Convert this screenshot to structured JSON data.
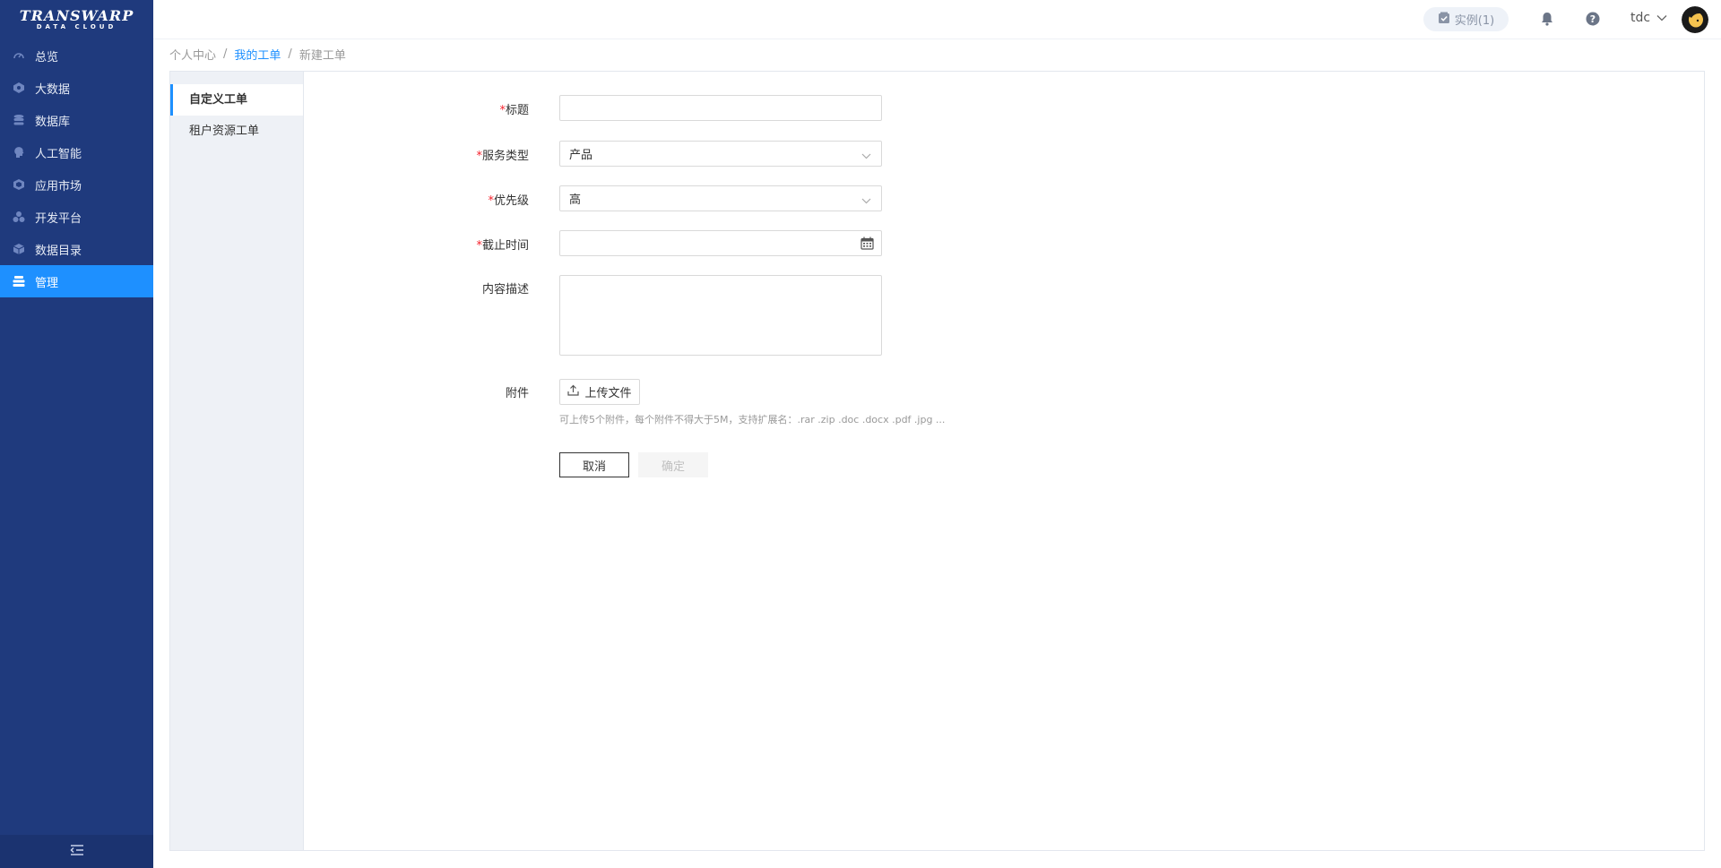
{
  "logo": {
    "line1": "TRANSWARP",
    "line2": "DATA CLOUD"
  },
  "sidebar": {
    "items": [
      {
        "label": "总览",
        "icon": "dashboard-icon",
        "active": false
      },
      {
        "label": "大数据",
        "icon": "bigdata-icon",
        "active": false
      },
      {
        "label": "数据库",
        "icon": "database-icon",
        "active": false
      },
      {
        "label": "人工智能",
        "icon": "ai-icon",
        "active": false
      },
      {
        "label": "应用市场",
        "icon": "app-market-icon",
        "active": false
      },
      {
        "label": "开发平台",
        "icon": "dev-platform-icon",
        "active": false
      },
      {
        "label": "数据目录",
        "icon": "data-catalog-icon",
        "active": false
      },
      {
        "label": "管理",
        "icon": "management-icon",
        "active": true
      }
    ],
    "collapse_icon": "collapse-menu-icon"
  },
  "header": {
    "instance_label": "实例(1)",
    "username": "tdc"
  },
  "breadcrumb": {
    "items": [
      "个人中心",
      "我的工单",
      "新建工单"
    ],
    "separator": "/"
  },
  "subnav": {
    "items": [
      "自定义工单",
      "租户资源工单"
    ],
    "active_index": 0
  },
  "form": {
    "title": {
      "label": "标题",
      "required": true,
      "value": ""
    },
    "service_type": {
      "label": "服务类型",
      "required": true,
      "value": "产品"
    },
    "priority": {
      "label": "优先级",
      "required": true,
      "value": "高"
    },
    "deadline": {
      "label": "截止时间",
      "required": true,
      "value": ""
    },
    "description": {
      "label": "内容描述",
      "required": false,
      "value": ""
    },
    "attachment": {
      "label": "附件",
      "upload_label": "上传文件",
      "hint": "可上传5个附件，每个附件不得大于5M，支持扩展名：.rar .zip .doc .docx .pdf .jpg ..."
    },
    "cancel_label": "取消",
    "ok_label": "确定"
  },
  "colors": {
    "sidebar_bg": "#1f3a7d",
    "accent": "#1e90ff",
    "required": "#f5222d"
  }
}
